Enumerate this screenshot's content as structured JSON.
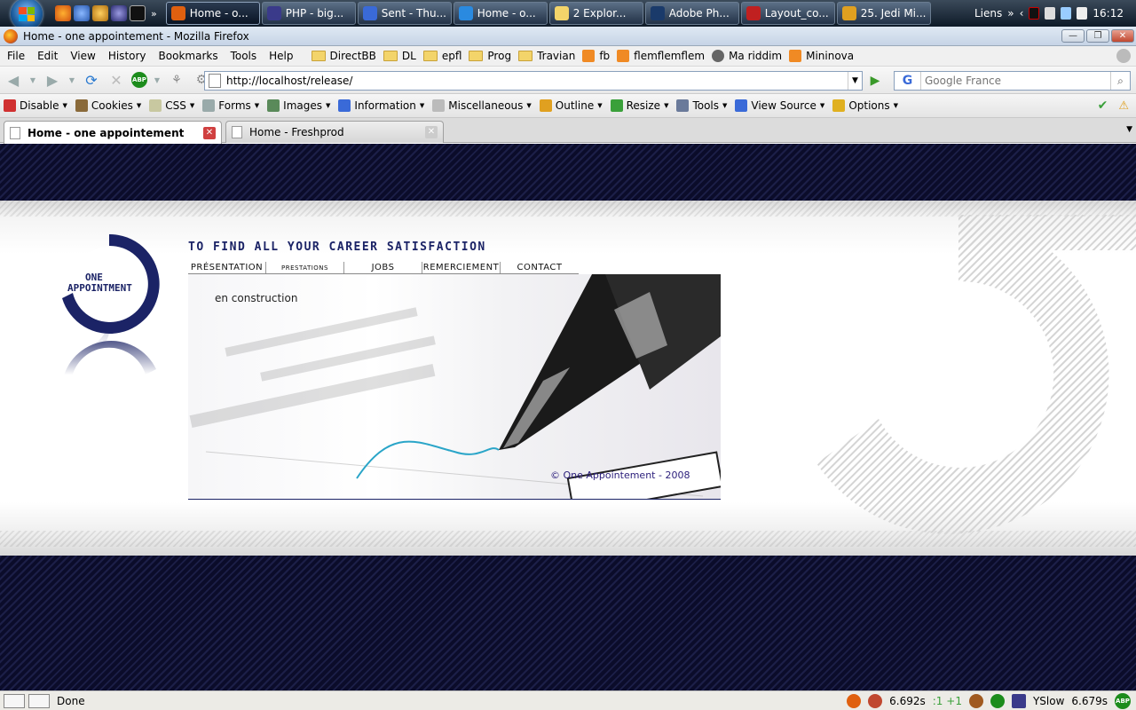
{
  "taskbar": {
    "more_label": "»",
    "tasks": [
      {
        "label": "Home - o...",
        "icon": "firefox-icon",
        "color": "#e0600f"
      },
      {
        "label": "PHP - big...",
        "icon": "eclipse-icon",
        "color": "#3a3a8a"
      },
      {
        "label": "Sent - Thu...",
        "icon": "thunderbird-icon",
        "color": "#3a6ad8"
      },
      {
        "label": "Home - o...",
        "icon": "ie-icon",
        "color": "#2a8ae0"
      },
      {
        "label": "2 Explor...",
        "icon": "explorer-folder-icon",
        "color": "#f3d46a"
      },
      {
        "label": "Adobe Ph...",
        "icon": "photoshop-icon",
        "color": "#1a3a6a"
      },
      {
        "label": "Layout_co...",
        "icon": "pdf-icon",
        "color": "#c02020"
      },
      {
        "label": "25. Jedi Mi...",
        "icon": "winamp-icon",
        "color": "#e0a020"
      }
    ],
    "links_label": "Liens",
    "links_more": "»",
    "clock": "16:12"
  },
  "window": {
    "title": "Home - one appointement - Mozilla Firefox",
    "minimize": "—",
    "maximize": "❐",
    "close": "✕"
  },
  "menubar": {
    "items": [
      "File",
      "Edit",
      "View",
      "History",
      "Bookmarks",
      "Tools",
      "Help"
    ],
    "bookmarks": [
      {
        "label": "DirectBB",
        "type": "folder"
      },
      {
        "label": "DL",
        "type": "folder"
      },
      {
        "label": "epfl",
        "type": "folder"
      },
      {
        "label": "Prog",
        "type": "folder"
      },
      {
        "label": "Travian",
        "type": "folder"
      },
      {
        "label": "fb",
        "type": "rss"
      },
      {
        "label": "flemflemflem",
        "type": "rss"
      },
      {
        "label": "Ma riddim",
        "type": "info"
      },
      {
        "label": "Mininova",
        "type": "rss"
      }
    ]
  },
  "navbar": {
    "url": "http://localhost/release/",
    "search_placeholder": "Google France",
    "search_engine": "G",
    "abp_label": "ABP"
  },
  "webdev": {
    "items": [
      {
        "label": "Disable",
        "icon": "disable-icon",
        "color": "#d03030"
      },
      {
        "label": "Cookies",
        "icon": "cookies-icon",
        "color": "#8a6a3a"
      },
      {
        "label": "CSS",
        "icon": "css-icon",
        "color": "#c8c8a0"
      },
      {
        "label": "Forms",
        "icon": "forms-icon",
        "color": "#9aa"
      },
      {
        "label": "Images",
        "icon": "images-icon",
        "color": "#5a8a5a"
      },
      {
        "label": "Information",
        "icon": "information-icon",
        "color": "#3a6ad8"
      },
      {
        "label": "Miscellaneous",
        "icon": "miscellaneous-icon",
        "color": "#bbb"
      },
      {
        "label": "Outline",
        "icon": "outline-icon",
        "color": "#e0a020"
      },
      {
        "label": "Resize",
        "icon": "resize-icon",
        "color": "#3aa03a"
      },
      {
        "label": "Tools",
        "icon": "tools-icon",
        "color": "#6a7a9a"
      },
      {
        "label": "View Source",
        "icon": "view-source-icon",
        "color": "#3a6ad8"
      },
      {
        "label": "Options",
        "icon": "options-icon",
        "color": "#e0b020"
      }
    ]
  },
  "tabs": [
    {
      "label": "Home - one appointement",
      "selected": true
    },
    {
      "label": "Home - Freshprod",
      "selected": false
    }
  ],
  "page": {
    "logo_line1": "ONE",
    "logo_line2": "APPOINTMENT",
    "tagline": "TO FIND ALL YOUR CAREER SATISFACTION",
    "nav": [
      {
        "label": "PRÉSENTATION",
        "small": false
      },
      {
        "label": "PRESTATIONS",
        "small": true
      },
      {
        "label": "JOBS",
        "small": false
      },
      {
        "label": "REMERCIEMENT",
        "small": false
      },
      {
        "label": "CONTACT",
        "small": false
      }
    ],
    "status_text": "en construction",
    "copyright": "© One Appointement - 2008"
  },
  "statusbar": {
    "text": "Done",
    "time1": "6.692s",
    "counter": ":1 +1",
    "yslow": "YSlow",
    "time2": "6.679s",
    "abp": "ABP"
  },
  "colors": {
    "brand_navy": "#1b2366",
    "band_dark": "#0b0c2a"
  }
}
